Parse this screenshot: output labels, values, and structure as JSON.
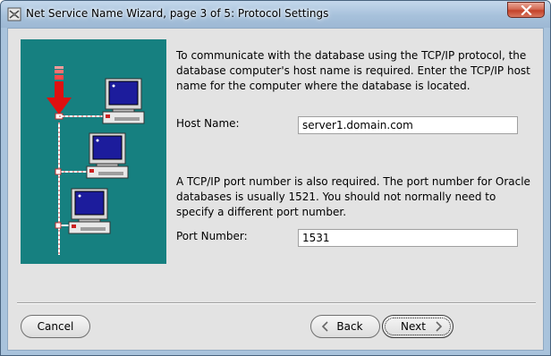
{
  "window": {
    "title": "Net Service Name Wizard, page 3 of 5: Protocol Settings",
    "close_icon": "close-icon"
  },
  "content": {
    "description1": "To communicate with the database using the TCP/IP protocol, the database computer's host name is required.  Enter the TCP/IP host name for the computer where the database is located.",
    "host_label": "Host Name:",
    "host_value": "server1.domain.com",
    "description2": "A TCP/IP port number is also required.  The port number for Oracle databases is usually 1521.  You should not normally need to specify a different port number.",
    "port_label": "Port Number:",
    "port_value": "1531"
  },
  "buttons": {
    "cancel": "Cancel",
    "back": "Back",
    "next": "Next"
  },
  "colors": {
    "illustration_bg": "#168080",
    "arrow": "#e01010"
  }
}
